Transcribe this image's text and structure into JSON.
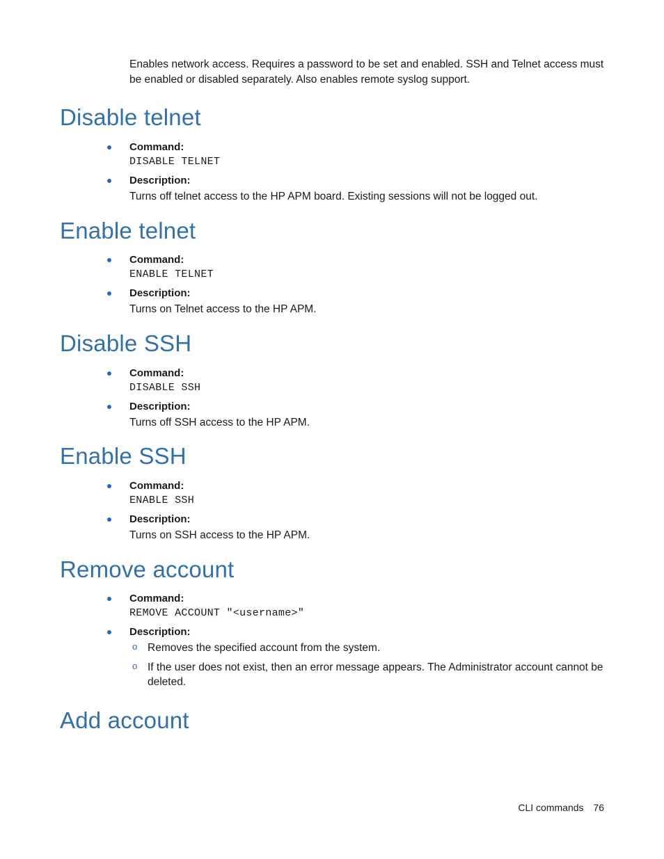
{
  "intro": "Enables network access. Requires a password to be set and enabled. SSH and Telnet access must be enabled or disabled separately. Also enables remote syslog support.",
  "labels": {
    "command": "Command:",
    "description": "Description:"
  },
  "sections": {
    "s1": {
      "title": "Disable telnet",
      "cmd": "DISABLE TELNET",
      "desc": "Turns off telnet access to the HP APM board. Existing sessions will not be logged out."
    },
    "s2": {
      "title": "Enable telnet",
      "cmd": "ENABLE TELNET",
      "desc": "Turns on Telnet access to the HP APM."
    },
    "s3": {
      "title": "Disable SSH",
      "cmd": "DISABLE SSH",
      "desc": "Turns off SSH access to the HP APM."
    },
    "s4": {
      "title": "Enable SSH",
      "cmd": "ENABLE SSH",
      "desc": "Turns on SSH access to the HP APM."
    },
    "s5": {
      "title": "Remove account",
      "cmd": "REMOVE ACCOUNT \"<username>\"",
      "sub1": "Removes the specified account from the system.",
      "sub2": "If the user does not exist, then an error message appears. The Administrator account cannot be deleted."
    },
    "s6": {
      "title": "Add account"
    }
  },
  "footer": {
    "section": "CLI commands",
    "page": "76"
  }
}
